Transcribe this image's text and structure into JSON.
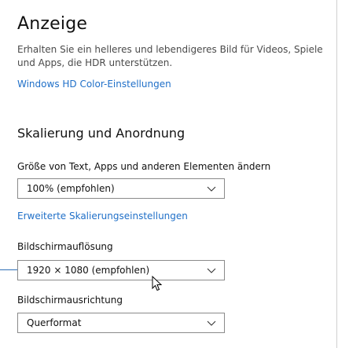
{
  "page": {
    "title": "Anzeige",
    "description": "Erhalten Sie ein helleres und lebendigeres Bild für Videos, Spiele und Apps, die HDR unterstützen.",
    "hdr_link": "Windows HD Color-Einstellungen"
  },
  "scaling_section": {
    "heading": "Skalierung und Anordnung",
    "size_label": "Größe von Text, Apps und anderen Elementen ändern",
    "size_value": "100% (empfohlen)",
    "advanced_link": "Erweiterte Skalierungseinstellungen",
    "resolution_label": "Bildschirmauflösung",
    "resolution_value": "1920 × 1080 (empfohlen)",
    "orientation_label": "Bildschirmausrichtung",
    "orientation_value": "Querformat"
  },
  "colors": {
    "link": "#1f6fc8",
    "callout": "#2d6fb5"
  },
  "icons": {
    "dropdown": "chevron-down-icon",
    "pointer": "mouse-cursor-icon"
  }
}
